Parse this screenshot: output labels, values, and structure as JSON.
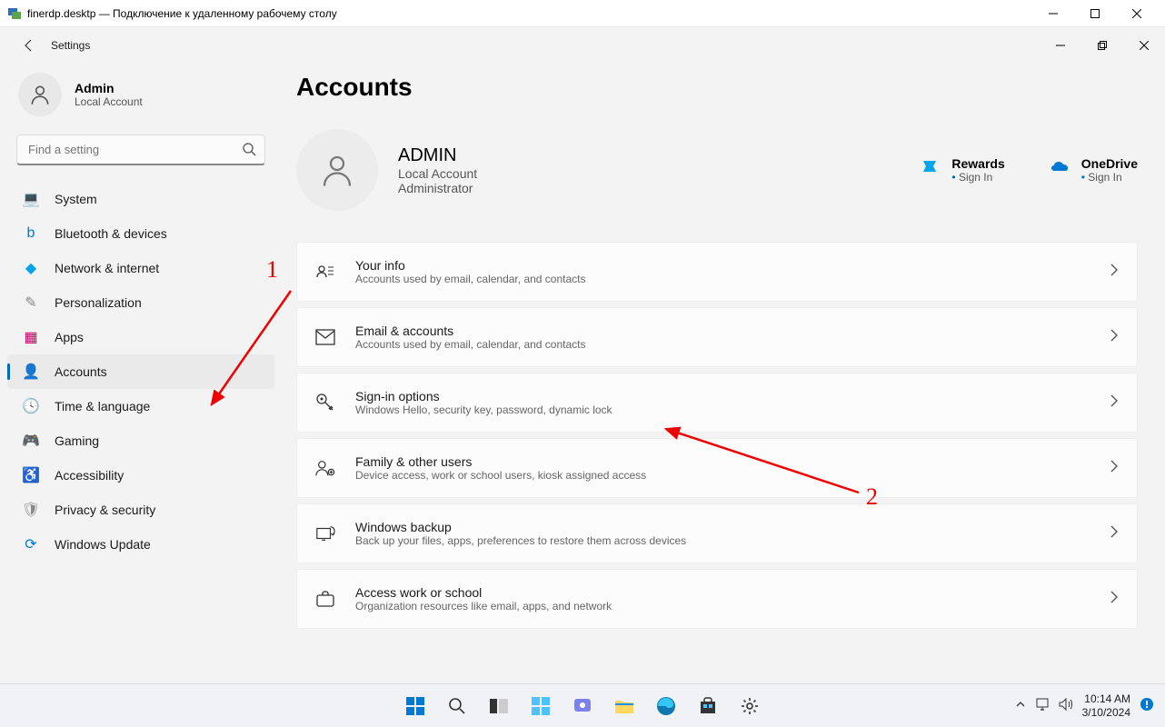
{
  "rdp": {
    "title": "finerdp.desktp — Подключение к удаленному рабочему столу"
  },
  "settings": {
    "title": "Settings",
    "profile": {
      "name": "Admin",
      "sub": "Local Account"
    },
    "search_placeholder": "Find a setting",
    "nav": [
      {
        "label": "System",
        "icon": "💻",
        "color": "#0078d4"
      },
      {
        "label": "Bluetooth & devices",
        "icon": "b",
        "color": "#0078d4"
      },
      {
        "label": "Network & internet",
        "icon": "◆",
        "color": "#00a2ed"
      },
      {
        "label": "Personalization",
        "icon": "✎",
        "color": "#888"
      },
      {
        "label": "Apps",
        "icon": "▦",
        "color": "#c06"
      },
      {
        "label": "Accounts",
        "icon": "👤",
        "color": "#1b8",
        "active": true
      },
      {
        "label": "Time & language",
        "icon": "🕓",
        "color": "#666"
      },
      {
        "label": "Gaming",
        "icon": "🎮",
        "color": "#666"
      },
      {
        "label": "Accessibility",
        "icon": "♿",
        "color": "#0078d4"
      },
      {
        "label": "Privacy & security",
        "icon": "🛡",
        "color": "#888"
      },
      {
        "label": "Windows Update",
        "icon": "⟳",
        "color": "#0078d4"
      }
    ]
  },
  "page": {
    "title": "Accounts",
    "account": {
      "name": "ADMIN",
      "line1": "Local Account",
      "line2": "Administrator"
    },
    "rewards": {
      "title": "Rewards",
      "link": "Sign In"
    },
    "onedrive": {
      "title": "OneDrive",
      "link": "Sign In"
    },
    "cards": [
      {
        "title": "Your info",
        "desc": "Accounts used by email, calendar, and contacts",
        "icon": "user-card"
      },
      {
        "title": "Email & accounts",
        "desc": "Accounts used by email, calendar, and contacts",
        "icon": "mail"
      },
      {
        "title": "Sign-in options",
        "desc": "Windows Hello, security key, password, dynamic lock",
        "icon": "key"
      },
      {
        "title": "Family & other users",
        "desc": "Device access, work or school users, kiosk assigned access",
        "icon": "users"
      },
      {
        "title": "Windows backup",
        "desc": "Back up your files, apps, preferences to restore them across devices",
        "icon": "backup"
      },
      {
        "title": "Access work or school",
        "desc": "Organization resources like email, apps, and network",
        "icon": "briefcase"
      }
    ]
  },
  "taskbar": {
    "time": "10:14 AM",
    "date": "3/10/2024"
  },
  "annotations": {
    "num1": "1",
    "num2": "2"
  }
}
